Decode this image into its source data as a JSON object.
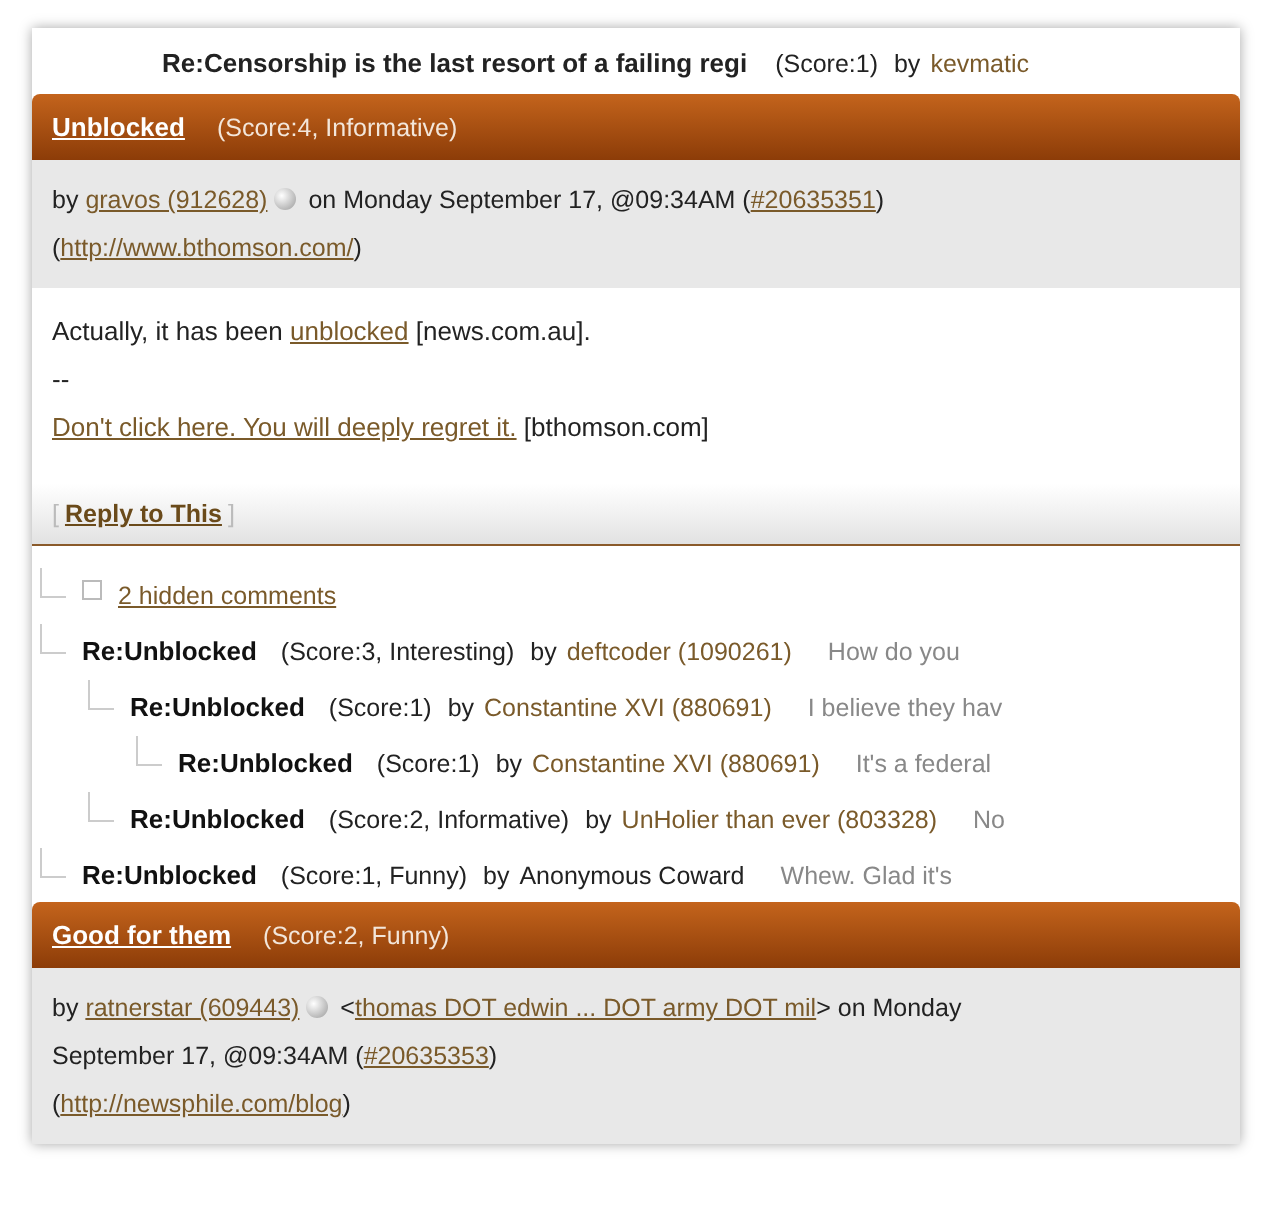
{
  "top_comment": {
    "title": "Re:Censorship is the last resort of a failing regi",
    "score": "(Score:1)",
    "by": "by",
    "author": "kevmatic"
  },
  "comments": [
    {
      "title": "Unblocked",
      "score": "(Score:4, Informative)",
      "meta": [
        {
          "kind": "text",
          "text": "by "
        },
        {
          "kind": "link",
          "text": "gravos (912628)"
        },
        {
          "kind": "dot"
        },
        {
          "kind": "text",
          "text": " on Monday September 17, @09:34AM ("
        },
        {
          "kind": "link",
          "text": "#20635351"
        },
        {
          "kind": "text",
          "text": ")"
        },
        {
          "kind": "break"
        },
        {
          "kind": "text",
          "text": "("
        },
        {
          "kind": "link",
          "text": "http://www.bthomson.com/"
        },
        {
          "kind": "text",
          "text": ")"
        }
      ],
      "body": [
        [
          {
            "kind": "text",
            "text": "Actually, it has been "
          },
          {
            "kind": "link",
            "text": "unblocked"
          },
          {
            "kind": "text",
            "text": " [news.com.au]."
          }
        ],
        [
          {
            "kind": "text",
            "text": "--"
          }
        ],
        [
          {
            "kind": "link",
            "text": "Don't click here. You will deeply regret it."
          },
          {
            "kind": "text",
            "text": " [bthomson.com]"
          }
        ]
      ],
      "reply_open": "[",
      "reply": "Reply to This",
      "reply_close": "]",
      "replies": [
        {
          "kind": "hidden",
          "text": "2 hidden comments"
        },
        {
          "kind": "reply",
          "title": "Re:Unblocked",
          "score": "(Score:3, Interesting)",
          "by": "by",
          "author": "deftcoder (1090261)",
          "author_link": true,
          "snippet": "How do you",
          "children": [
            {
              "kind": "reply",
              "title": "Re:Unblocked",
              "score": "(Score:1)",
              "by": "by",
              "author": "Constantine XVI (880691)",
              "author_link": true,
              "snippet": "I believe they hav",
              "children": [
                {
                  "kind": "reply",
                  "title": "Re:Unblocked",
                  "score": "(Score:1)",
                  "by": "by",
                  "author": "Constantine XVI (880691)",
                  "author_link": true,
                  "snippet": "It's a federal"
                }
              ]
            },
            {
              "kind": "reply",
              "title": "Re:Unblocked",
              "score": "(Score:2, Informative)",
              "by": "by",
              "author": "UnHolier than ever (803328)",
              "author_link": true,
              "snippet": "No"
            }
          ]
        },
        {
          "kind": "reply",
          "title": "Re:Unblocked",
          "score": "(Score:1, Funny)",
          "by": "by",
          "author": "Anonymous Coward",
          "author_link": false,
          "snippet": "Whew. Glad it's"
        }
      ]
    },
    {
      "title": "Good for them",
      "score": "(Score:2, Funny)",
      "meta": [
        {
          "kind": "text",
          "text": "by "
        },
        {
          "kind": "link",
          "text": "ratnerstar (609443)"
        },
        {
          "kind": "dot"
        },
        {
          "kind": "text",
          "text": " <"
        },
        {
          "kind": "link",
          "text": "thomas DOT edwin ... DOT army DOT mil"
        },
        {
          "kind": "text",
          "text": "> on Monday"
        },
        {
          "kind": "break"
        },
        {
          "kind": "text",
          "text": "September 17, @09:34AM ("
        },
        {
          "kind": "link",
          "text": "#20635353"
        },
        {
          "kind": "text",
          "text": ")"
        },
        {
          "kind": "break"
        },
        {
          "kind": "text",
          "text": "("
        },
        {
          "kind": "link",
          "text": "http://newsphile.com/blog"
        },
        {
          "kind": "text",
          "text": ")"
        }
      ]
    }
  ]
}
